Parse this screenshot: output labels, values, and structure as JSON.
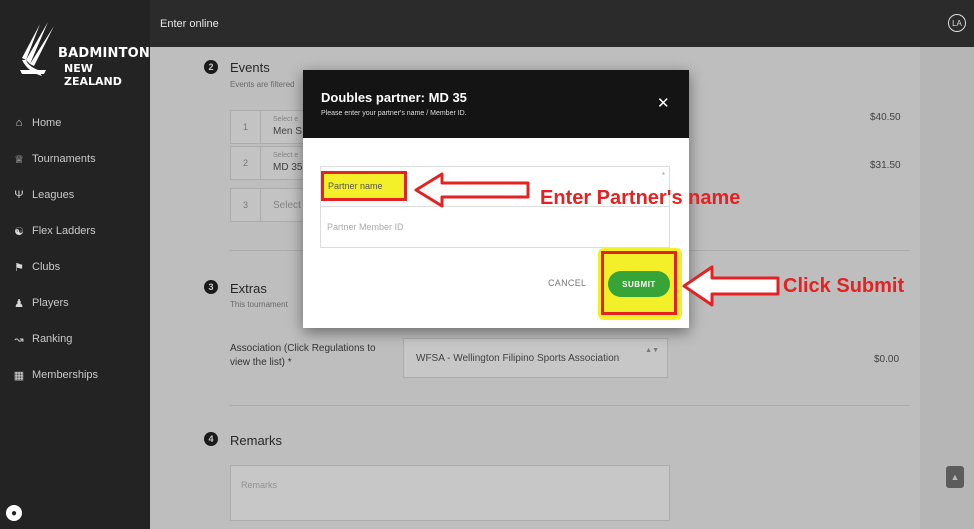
{
  "app": {
    "logo_line1": "BADMINTON",
    "logo_line2": "NEW ZEALAND",
    "topbar_title": "Enter online",
    "avatar_initials": "LA"
  },
  "sidebar": {
    "items": [
      {
        "label": "Home",
        "icon": "home-icon"
      },
      {
        "label": "Tournaments",
        "icon": "trophy-icon"
      },
      {
        "label": "Leagues",
        "icon": "trophy-cup-icon"
      },
      {
        "label": "Flex Ladders",
        "icon": "ladder-icon"
      },
      {
        "label": "Clubs",
        "icon": "flag-icon"
      },
      {
        "label": "Players",
        "icon": "players-icon"
      },
      {
        "label": "Ranking",
        "icon": "chart-icon"
      },
      {
        "label": "Memberships",
        "icon": "card-icon"
      }
    ]
  },
  "events": {
    "step": "2",
    "title": "Events",
    "subtitle": "Events are filtered",
    "rows": [
      {
        "num": "1",
        "small": "Select e",
        "value": "Men S",
        "price": "$40.50"
      },
      {
        "num": "2",
        "small": "Select e",
        "value": "MD 35",
        "price": "$31.50"
      },
      {
        "num": "3",
        "small": "",
        "value": "Select",
        "price": ""
      }
    ]
  },
  "extras": {
    "step": "3",
    "title": "Extras",
    "subtitle": "This tournament",
    "association_label": "Association (Click Regulations to view the list) *",
    "association_value": "WFSA - Wellington Filipino Sports Association",
    "association_price": "$0.00"
  },
  "remarks": {
    "step": "4",
    "title": "Remarks",
    "placeholder": "Remarks"
  },
  "modal": {
    "title": "Doubles partner: MD 35",
    "subtitle": "Please enter your partner's name / Member ID.",
    "close": "✕",
    "partner_name_placeholder": "Partner name",
    "partner_id_placeholder": "Partner Member ID",
    "required_mark": "*",
    "cancel_label": "CANCEL",
    "submit_label": "SUBMIT"
  },
  "annotations": {
    "enter_name": "Enter Partner's name",
    "click_submit": "Click Submit",
    "color": "#e32323",
    "highlight": "#f3ef29"
  },
  "colors": {
    "sidebar": "#232323",
    "submit": "#37a437"
  }
}
